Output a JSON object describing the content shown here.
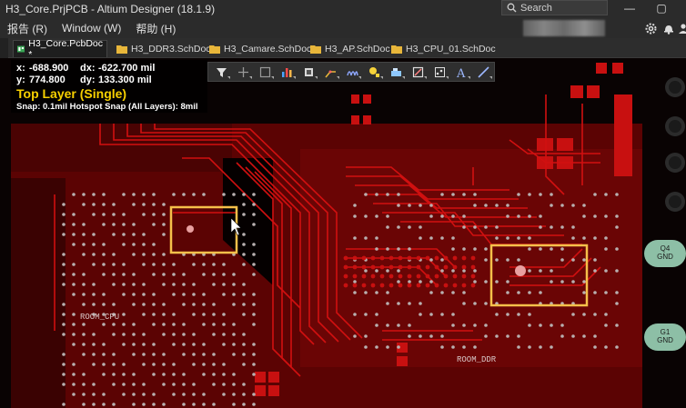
{
  "window": {
    "title": "H3_Core.PrjPCB - Altium Designer (18.1.9)",
    "search_placeholder": "Search",
    "minimize": "—",
    "restore": "▢"
  },
  "menu": {
    "items": [
      "报告 (R)",
      "Window (W)",
      "帮助 (H)"
    ]
  },
  "tabs": [
    {
      "label": "H3_Core.PcbDoc *",
      "active": true
    },
    {
      "label": "H3_DDR3.SchDoc",
      "active": false
    },
    {
      "label": "H3_Camare.SchDoc",
      "active": false
    },
    {
      "label": "H3_AP.SchDoc",
      "active": false
    },
    {
      "label": "H3_CPU_01.SchDoc",
      "active": false
    }
  ],
  "hud": {
    "x_label": "x:",
    "x_value": "-688.900",
    "dx_label": "dx:",
    "dx_value": "-622.700 mil",
    "y_label": "y:",
    "y_value": "774.800",
    "dy_label": "dy:",
    "dy_value": "133.300 mil",
    "layer": "Top Layer (Single)",
    "snap": "Snap: 0.1mil Hotspot Snap (All Layers): 8mil"
  },
  "activebar_icons": [
    "filter-icon",
    "cross-icon",
    "select-rect-icon",
    "chart-icon",
    "component-icon",
    "route-icon",
    "interactive-route-icon",
    "pad-icon",
    "fill-icon",
    "region-icon",
    "via-array-icon",
    "string-icon",
    "line-icon"
  ],
  "rooms": {
    "cpu": "ROOM_CPU",
    "ddr": "ROOM_DDR"
  },
  "pads": {
    "q4": [
      "Q4",
      "GND"
    ],
    "g1": [
      "G1",
      "GND"
    ]
  },
  "colors": {
    "board": "#5e0404",
    "trace": "#d11010",
    "via": "#b8b0b0",
    "highlight": "#f5c04a",
    "hud_layer": "#f7d000",
    "pad_gnd": "#8dbfa6"
  }
}
